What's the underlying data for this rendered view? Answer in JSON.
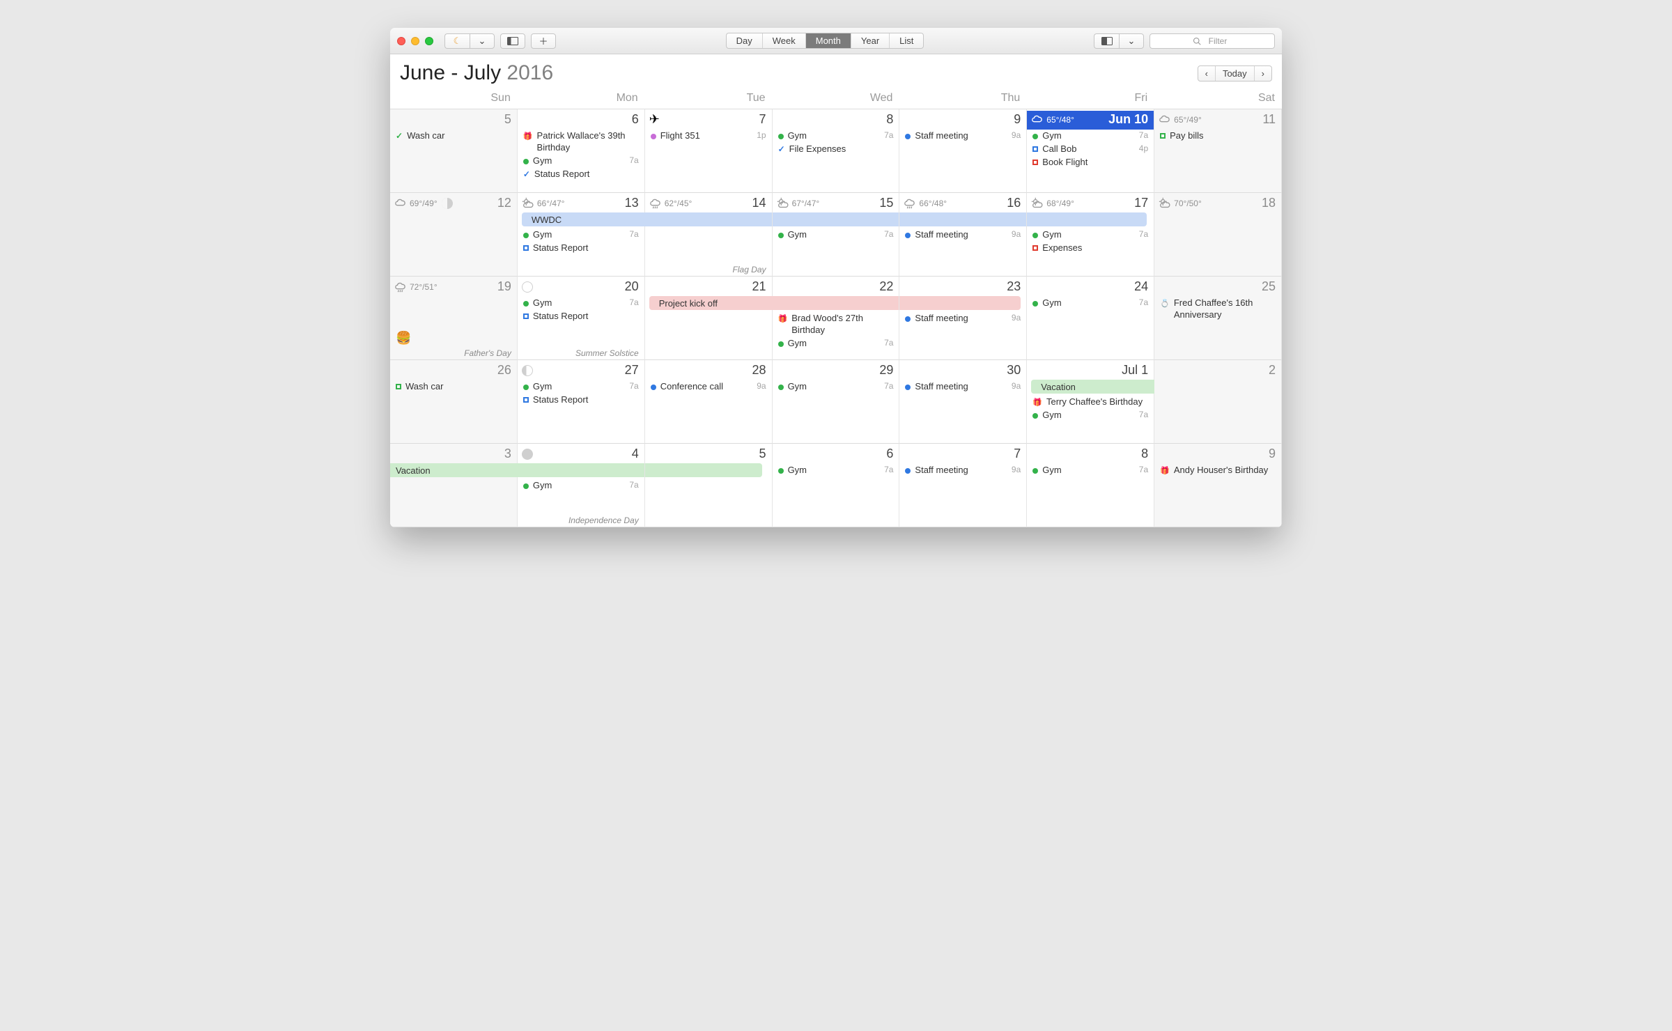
{
  "toolbar": {
    "views": [
      "Day",
      "Week",
      "Month",
      "Year",
      "List"
    ],
    "activeView": "Month",
    "filterPlaceholder": "Filter"
  },
  "header": {
    "titleMain": "June - July ",
    "titleYear": "2016",
    "todayLabel": "Today"
  },
  "dow": [
    "Sun",
    "Mon",
    "Tue",
    "Wed",
    "Thu",
    "Fri",
    "Sat"
  ],
  "colors": {
    "green": "#33b24a",
    "blue": "#2f78e1",
    "red": "#e03b2f",
    "magenta": "#c86dd7",
    "wwdcBanner": "#c8daf6",
    "kickoffBanner": "#f6cfcf",
    "vacationBanner": "#cdeccd"
  },
  "cells": [
    {
      "date": "5",
      "out": true,
      "events": [
        {
          "icon": "check",
          "color": "green",
          "label": "Wash car"
        }
      ]
    },
    {
      "date": "6",
      "events": [
        {
          "icon": "gift",
          "color": "red",
          "label": "Patrick Wallace's 39th Birthday"
        },
        {
          "icon": "dot",
          "color": "green",
          "label": "Gym",
          "time": "7a"
        },
        {
          "icon": "check",
          "color": "blue",
          "label": "Status Report"
        }
      ]
    },
    {
      "date": "7",
      "topIcon": "plane",
      "events": [
        {
          "icon": "dot",
          "color": "magenta",
          "label": "Flight 351",
          "time": "1p"
        }
      ]
    },
    {
      "date": "8",
      "events": [
        {
          "icon": "dot",
          "color": "green",
          "label": "Gym",
          "time": "7a"
        },
        {
          "icon": "check",
          "color": "blue",
          "label": "File Expenses"
        }
      ]
    },
    {
      "date": "9",
      "events": [
        {
          "icon": "dot",
          "color": "blue",
          "label": "Staff meeting",
          "time": "9a"
        }
      ]
    },
    {
      "date": "Jun 10",
      "today": true,
      "weather": {
        "t": "65°/48°",
        "kind": "mix"
      },
      "events": [
        {
          "icon": "dot",
          "color": "green",
          "label": "Gym",
          "time": "7a"
        },
        {
          "icon": "sq",
          "color": "blue",
          "label": "Call Bob",
          "time": "4p"
        },
        {
          "icon": "sq",
          "color": "red",
          "label": "Book Flight"
        }
      ]
    },
    {
      "date": "11",
      "out": true,
      "weather": {
        "t": "65°/49°",
        "kind": "mix"
      },
      "events": [
        {
          "icon": "sq",
          "color": "green",
          "label": "Pay bills"
        }
      ]
    },
    {
      "date": "12",
      "out": true,
      "weather": {
        "t": "69°/49°",
        "kind": "cloud"
      },
      "moon": "half"
    },
    {
      "date": "13",
      "weather": {
        "t": "66°/47°",
        "kind": "sun"
      },
      "bannerStart": {
        "key": "wwdc",
        "label": "WWDC",
        "color": "wwdcBanner",
        "span": 5
      },
      "events": [
        {
          "spacer": true
        },
        {
          "icon": "dot",
          "color": "green",
          "label": "Gym",
          "time": "7a"
        },
        {
          "icon": "sq",
          "color": "blue",
          "label": "Status Report"
        }
      ]
    },
    {
      "date": "14",
      "weather": {
        "t": "62°/45°",
        "kind": "rain"
      },
      "footnote": "Flag Day"
    },
    {
      "date": "15",
      "weather": {
        "t": "67°/47°",
        "kind": "sun"
      },
      "events": [
        {
          "spacer": true
        },
        {
          "icon": "dot",
          "color": "green",
          "label": "Gym",
          "time": "7a"
        }
      ]
    },
    {
      "date": "16",
      "weather": {
        "t": "66°/48°",
        "kind": "rain"
      },
      "events": [
        {
          "spacer": true
        },
        {
          "icon": "dot",
          "color": "blue",
          "label": "Staff meeting",
          "time": "9a"
        }
      ]
    },
    {
      "date": "17",
      "weather": {
        "t": "68°/49°",
        "kind": "sun"
      },
      "events": [
        {
          "spacer": true
        },
        {
          "icon": "dot",
          "color": "green",
          "label": "Gym",
          "time": "7a"
        },
        {
          "icon": "sq",
          "color": "red",
          "label": "Expenses"
        }
      ]
    },
    {
      "date": "18",
      "out": true,
      "weather": {
        "t": "70°/50°",
        "kind": "sun"
      }
    },
    {
      "date": "19",
      "out": true,
      "weather": {
        "t": "72°/51°",
        "kind": "rain"
      },
      "footnote": "Father's Day",
      "emoji": "burger"
    },
    {
      "date": "20",
      "moon": "new",
      "footnote": "Summer Solstice",
      "events": [
        {
          "icon": "dot",
          "color": "green",
          "label": "Gym",
          "time": "7a"
        },
        {
          "icon": "sq",
          "color": "blue",
          "label": "Status Report"
        }
      ]
    },
    {
      "date": "21",
      "bannerStart": {
        "key": "kickoff",
        "label": "Project kick off",
        "color": "kickoffBanner",
        "span": 3
      }
    },
    {
      "date": "22",
      "events": [
        {
          "spacer": true
        },
        {
          "icon": "gift",
          "color": "red",
          "label": "Brad Wood's 27th Birthday"
        },
        {
          "icon": "dot",
          "color": "green",
          "label": "Gym",
          "time": "7a"
        }
      ]
    },
    {
      "date": "23",
      "events": [
        {
          "spacer": true
        },
        {
          "icon": "dot",
          "color": "blue",
          "label": "Staff meeting",
          "time": "9a"
        }
      ]
    },
    {
      "date": "24",
      "events": [
        {
          "icon": "dot",
          "color": "green",
          "label": "Gym",
          "time": "7a"
        }
      ]
    },
    {
      "date": "25",
      "out": true,
      "events": [
        {
          "icon": "ring",
          "color": "red",
          "label": "Fred Chaffee's 16th Anniversary"
        }
      ]
    },
    {
      "date": "26",
      "out": true,
      "events": [
        {
          "icon": "sq",
          "color": "green",
          "label": "Wash car"
        }
      ]
    },
    {
      "date": "27",
      "moon": "crescent",
      "events": [
        {
          "icon": "dot",
          "color": "green",
          "label": "Gym",
          "time": "7a"
        },
        {
          "icon": "sq",
          "color": "blue",
          "label": "Status Report"
        }
      ]
    },
    {
      "date": "28",
      "events": [
        {
          "icon": "dot",
          "color": "blue",
          "label": "Conference call",
          "time": "9a"
        }
      ]
    },
    {
      "date": "29",
      "events": [
        {
          "icon": "dot",
          "color": "green",
          "label": "Gym",
          "time": "7a"
        }
      ]
    },
    {
      "date": "30",
      "events": [
        {
          "icon": "dot",
          "color": "blue",
          "label": "Staff meeting",
          "time": "9a"
        }
      ]
    },
    {
      "date": "Jul 1",
      "bannerStart": {
        "key": "vacation",
        "label": "Vacation",
        "color": "vacationBanner",
        "span": 2,
        "openEnd": true
      },
      "events": [
        {
          "spacer": true
        },
        {
          "icon": "gift",
          "color": "red",
          "label": "Terry Chaffee's Birth­day"
        },
        {
          "icon": "dot",
          "color": "green",
          "label": "Gym",
          "time": "7a"
        }
      ]
    },
    {
      "date": "2",
      "out": true
    },
    {
      "date": "3",
      "out": true,
      "bannerStart": {
        "key": "vacation2",
        "label": "Vacation",
        "color": "vacationBanner",
        "span": 3,
        "openStart": true
      }
    },
    {
      "date": "4",
      "moon": "full",
      "footnote": "Independence Day",
      "events": [
        {
          "spacer": true
        },
        {
          "icon": "dot",
          "color": "green",
          "label": "Gym",
          "time": "7a"
        }
      ]
    },
    {
      "date": "5"
    },
    {
      "date": "6",
      "events": [
        {
          "icon": "dot",
          "color": "green",
          "label": "Gym",
          "time": "7a"
        }
      ]
    },
    {
      "date": "7",
      "events": [
        {
          "icon": "dot",
          "color": "blue",
          "label": "Staff meeting",
          "time": "9a"
        }
      ]
    },
    {
      "date": "8",
      "events": [
        {
          "icon": "dot",
          "color": "green",
          "label": "Gym",
          "time": "7a"
        }
      ]
    },
    {
      "date": "9",
      "out": true,
      "events": [
        {
          "icon": "gift",
          "color": "red",
          "label": "Andy Houser's Birthday"
        }
      ]
    }
  ]
}
